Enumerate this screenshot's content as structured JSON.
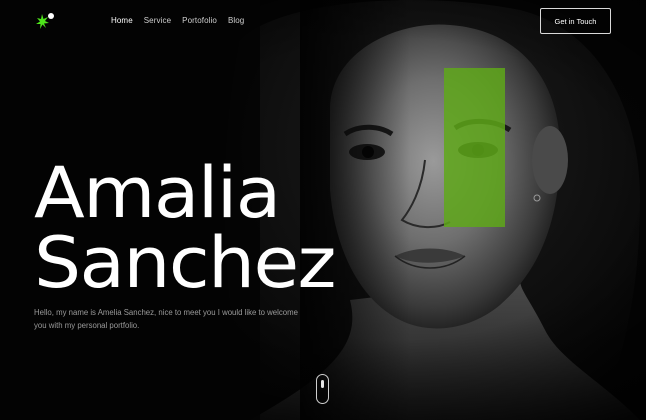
{
  "brand": {
    "logo_icon": "green-star-burst-icon",
    "accent": "#4ee51b"
  },
  "nav": {
    "items": [
      {
        "label": "Home",
        "active": true
      },
      {
        "label": "Service",
        "active": false
      },
      {
        "label": "Portofolio",
        "active": false
      },
      {
        "label": "Blog",
        "active": false
      }
    ],
    "cta_label": "Get in Touch"
  },
  "hero": {
    "name_line1": "Amalia",
    "name_line2": "Sanchez",
    "intro": "Hello, my name is Amelia Sanchez, nice to meet you I would like to welcome you with my personal portfolio.",
    "highlight_color": "#5a9e17"
  },
  "scroll_indicator": {
    "icon": "mouse-scroll-icon"
  }
}
